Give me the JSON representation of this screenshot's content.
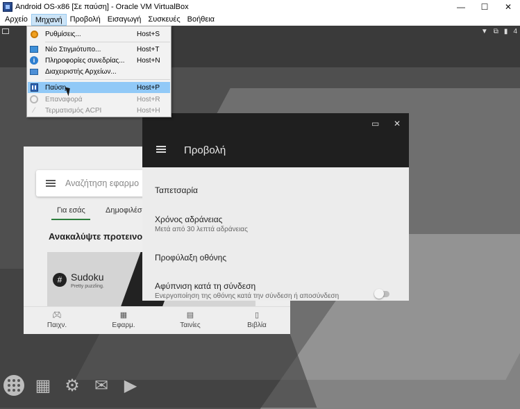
{
  "window": {
    "title": "Android OS-x86 [Σε παύση] - Oracle VM VirtualBox",
    "minimize": "—",
    "maximize": "☐",
    "close": "✕"
  },
  "menubar": [
    "Αρχείο",
    "Μηχανή",
    "Προβολή",
    "Εισαγωγή",
    "Συσκευές",
    "Βοήθεια"
  ],
  "machine_menu": {
    "items": [
      {
        "label": "Ρυθμίσεις...",
        "shortcut": "Host+S",
        "icon": "settings-gear-icon",
        "enabled": true
      },
      {
        "label": "Νέο Στιγμιότυπο...",
        "shortcut": "Host+T",
        "icon": "snapshot-icon",
        "enabled": true
      },
      {
        "label": "Πληροφορίες συνεδρίας...",
        "shortcut": "Host+N",
        "icon": "info-icon",
        "enabled": true
      },
      {
        "label": "Διαχειριστής Αρχείων...",
        "shortcut": "",
        "icon": "file-manager-icon",
        "enabled": true
      },
      {
        "label": "Παύση",
        "shortcut": "Host+P",
        "icon": "pause-icon",
        "enabled": true,
        "highlighted": true
      },
      {
        "label": "Επαναφορά",
        "shortcut": "Host+R",
        "icon": "reset-icon",
        "enabled": false
      },
      {
        "label": "Τερματισμός ACPI",
        "shortcut": "Host+H",
        "icon": "acpi-shutdown-icon",
        "enabled": false
      }
    ]
  },
  "play_store": {
    "search_placeholder": "Αναζήτηση εφαρμο",
    "tabs": [
      "Για εσάς",
      "Δημοφιλέσ"
    ],
    "section_title": "Ανακαλύψτε προτεινο",
    "banner": {
      "title": "Sudoku",
      "tagline": "Pretty puzzling."
    },
    "bottom_nav": [
      {
        "label": "Παιχν.",
        "icon": "gamepad-icon"
      },
      {
        "label": "Εφαρμ.",
        "icon": "apps-grid-icon"
      },
      {
        "label": "Ταινίες",
        "icon": "film-icon"
      },
      {
        "label": "Βιβλία",
        "icon": "book-icon"
      }
    ]
  },
  "display_settings": {
    "title": "Προβολή",
    "items": [
      {
        "title": "Ταπετσαρία",
        "subtitle": ""
      },
      {
        "title": "Χρόνος αδράνειας",
        "subtitle": "Μετά από 30 λεπτά αδράνειας"
      },
      {
        "title": "Προφύλαξη οθόνης",
        "subtitle": ""
      },
      {
        "title": "Αφύπνιση κατά τη σύνδεση",
        "subtitle": "Ενεργοποίηση της οθόνης κατά την σύνδεση ή αποσύνδεση"
      }
    ],
    "wake_on_connect_toggle": false
  },
  "status_bar": {
    "battery_text": "4"
  },
  "colors": {
    "menu_highlight": "#91c9f7",
    "active_menubar": "#cce4f7",
    "settings_header": "#1f1f1f"
  }
}
